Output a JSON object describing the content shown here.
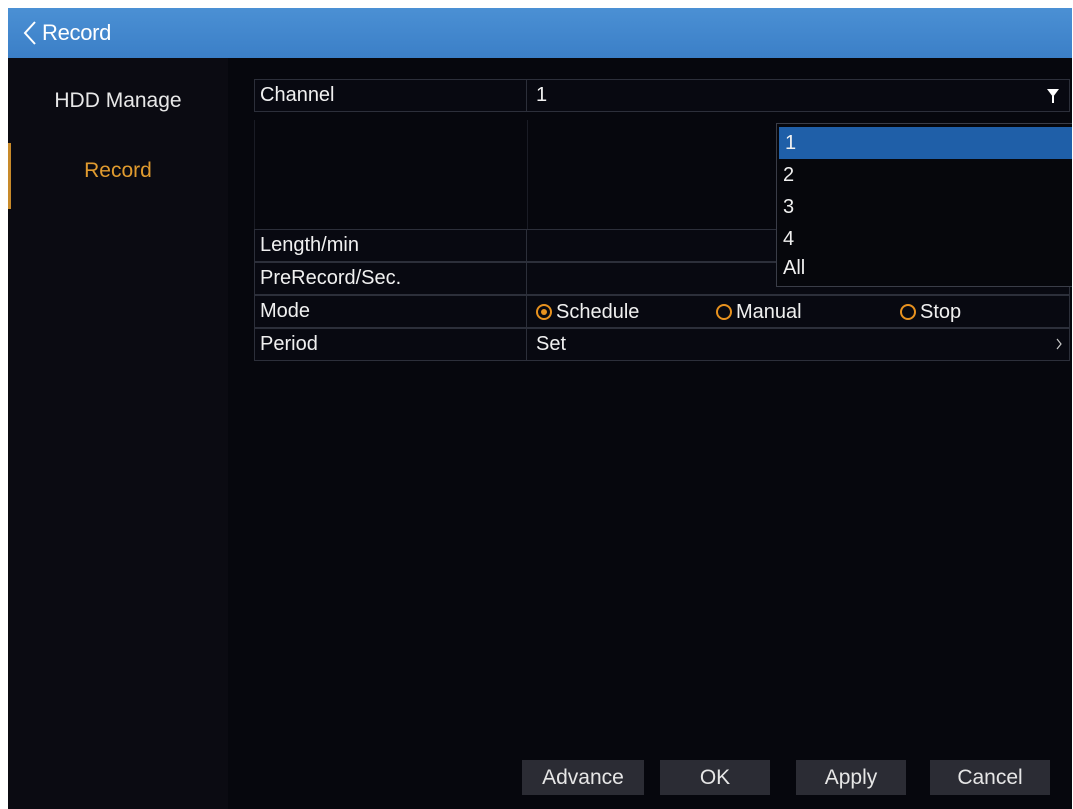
{
  "header": {
    "back_icon": "chevron-left-icon",
    "title": "Record"
  },
  "sidebar": {
    "items": [
      {
        "label": "HDD Manage",
        "active": false
      },
      {
        "label": "Record",
        "active": true
      }
    ]
  },
  "form": {
    "channel": {
      "label": "Channel",
      "value": "1"
    },
    "channel_dropdown": {
      "options": [
        "1",
        "2",
        "3",
        "4",
        "All"
      ],
      "selected": "1"
    },
    "length": {
      "label": "Length/min"
    },
    "prerecord": {
      "label": "PreRecord/Sec."
    },
    "mode": {
      "label": "Mode",
      "options": [
        "Schedule",
        "Manual",
        "Stop"
      ],
      "selected": "Schedule"
    },
    "period": {
      "label": "Period",
      "value": "Set"
    }
  },
  "buttons": {
    "advance": "Advance",
    "ok": "OK",
    "apply": "Apply",
    "cancel": "Cancel"
  },
  "colors": {
    "header": "#3b7fc7",
    "accent": "#e09b2f",
    "selection": "#1f5fa8",
    "background": "#06070d"
  }
}
